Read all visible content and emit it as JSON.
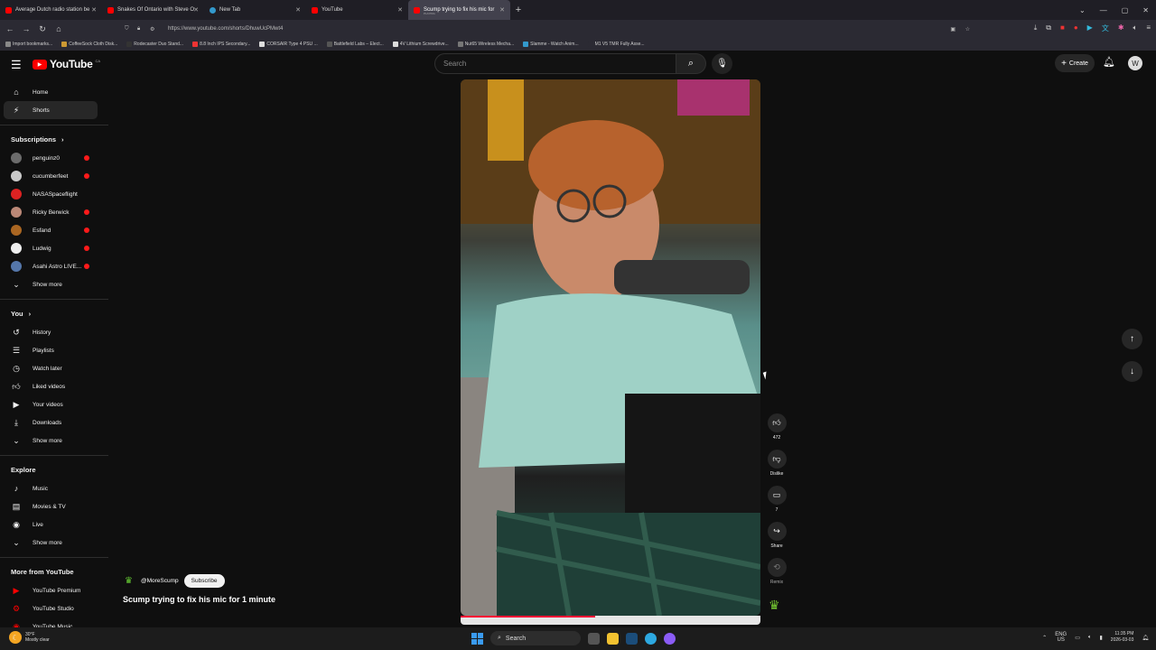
{
  "browser": {
    "tabs": [
      {
        "title": "Average Dutch radio station be",
        "color": "#ff0000",
        "sub": ""
      },
      {
        "title": "Snakes Of Ontario with Steve O",
        "color": "#ff0000",
        "sub": ""
      },
      {
        "title": "New Tab",
        "color": "#39c",
        "sub": ""
      },
      {
        "title": "YouTube",
        "color": "#ff0000",
        "sub": ""
      },
      {
        "title": "Scump trying to fix his mic for",
        "color": "#ff0000",
        "sub": "PLAYING"
      }
    ],
    "url": "https://www.youtube.com/shorts/DhuwUcPMwt4",
    "bookmarks": [
      "Import bookmarks...",
      "CoffeeSock Cloth Disk...",
      "Rodecaster Duo Stand...",
      "8.8 Inch IPS Secondary...",
      "CORSAIR Type 4 PSU ...",
      "Battlefield Labs – Elect...",
      "4V Lithium Screwdrive...",
      "Nut65 Wireless Mecha...",
      "Slamme - Watch Anim...",
      "M1 V5 TMR Fully Asse..."
    ]
  },
  "youtube": {
    "logo_text": "YouTube",
    "logo_country": "CA",
    "search_placeholder": "Search",
    "create_label": "Create",
    "avatar_letter": "W"
  },
  "sidebar": {
    "home": "Home",
    "shorts": "Shorts",
    "subscriptions_title": "Subscriptions",
    "channels": [
      {
        "name": "penguinz0",
        "color": "#6b6b6b"
      },
      {
        "name": "cucumberfeet",
        "color": "#c9c9c9"
      },
      {
        "name": "NASASpaceflight",
        "color": "#d22"
      },
      {
        "name": "Ricky Berwick",
        "color": "#b87"
      },
      {
        "name": "Esfand",
        "color": "#a62"
      },
      {
        "name": "Ludwig",
        "color": "#eee"
      },
      {
        "name": "Asahi Astro LIVE...",
        "color": "#57a"
      }
    ],
    "show_more": "Show more",
    "you_title": "You",
    "you_items": [
      {
        "label": "History",
        "icon": "↺"
      },
      {
        "label": "Playlists",
        "icon": "☰"
      },
      {
        "label": "Watch later",
        "icon": "◷"
      },
      {
        "label": "Liked videos",
        "icon": "👍"
      },
      {
        "label": "Your videos",
        "icon": "▶"
      },
      {
        "label": "Downloads",
        "icon": "⤓"
      }
    ],
    "explore_title": "Explore",
    "explore_items": [
      {
        "label": "Music",
        "icon": "♪"
      },
      {
        "label": "Movies & TV",
        "icon": "▤"
      },
      {
        "label": "Live",
        "icon": "◉"
      }
    ],
    "more_title": "More from YouTube",
    "more_items": [
      {
        "label": "YouTube Premium"
      },
      {
        "label": "YouTube Studio"
      },
      {
        "label": "YouTube Music"
      }
    ]
  },
  "short": {
    "channel": "@MoreScump",
    "subscribe": "Subscribe",
    "title": "Scump trying to fix his mic for 1 minute",
    "progress": 0.45,
    "likes": "472",
    "dislike": "Dislike",
    "comments": "7",
    "share": "Share",
    "remix": "Remix"
  },
  "taskbar": {
    "temp": "30°F",
    "weather": "Mostly clear",
    "search": "Search",
    "lang1": "ENG",
    "lang2": "US",
    "time": "11:35 PM",
    "date": "2026-03-03"
  },
  "colors": {
    "accent": "#ff0000",
    "background": "#0f0f0f"
  }
}
